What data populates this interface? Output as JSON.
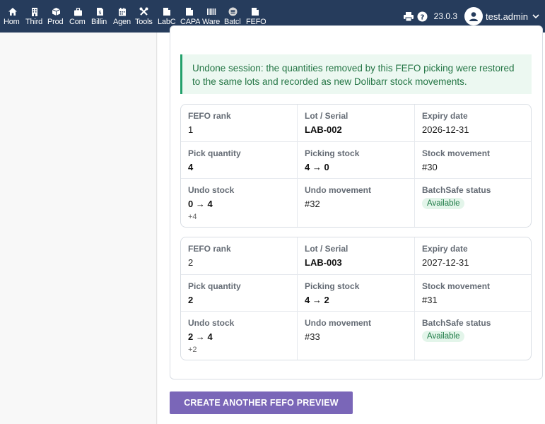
{
  "nav": {
    "items": [
      {
        "label": "Hom",
        "icon": "home-icon"
      },
      {
        "label": "Third",
        "icon": "building-icon"
      },
      {
        "label": "Prod",
        "icon": "cube-icon"
      },
      {
        "label": "Com",
        "icon": "briefcase-icon"
      },
      {
        "label": "Billin",
        "icon": "invoice-icon"
      },
      {
        "label": "Agen",
        "icon": "calendar-icon"
      },
      {
        "label": "Tools",
        "icon": "tools-icon"
      },
      {
        "label": "LabC",
        "icon": "doc-icon"
      },
      {
        "label": "CAPA",
        "icon": "doc-icon"
      },
      {
        "label": "Ware",
        "icon": "barcode-icon"
      },
      {
        "label": "Batcl",
        "icon": "batch-icon"
      },
      {
        "label": "FEFO",
        "icon": "doc-icon"
      }
    ]
  },
  "header": {
    "version": "23.0.3",
    "username": "test.admin"
  },
  "notice": {
    "text": "Undone session: the quantities removed by this FEFO picking were restored to the same lots and recorded as new Dolibarr stock movements."
  },
  "labels": {
    "rank": "FEFO rank",
    "lot": "Lot / Serial",
    "expiry": "Expiry date",
    "pick_qty": "Pick quantity",
    "picking_stock": "Picking stock",
    "stock_movement": "Stock movement",
    "undo_stock": "Undo stock",
    "undo_movement": "Undo movement",
    "status": "BatchSafe status"
  },
  "lines": [
    {
      "rank": "1",
      "lot": "LAB-002",
      "expiry": "2026-12-31",
      "pick_qty": "4",
      "picking_stock": "4 → 0",
      "stock_movement": "#30",
      "undo_stock": "0 → 4",
      "undo_delta": "+4",
      "undo_movement": "#32",
      "status": "Available"
    },
    {
      "rank": "2",
      "lot": "LAB-003",
      "expiry": "2027-12-31",
      "pick_qty": "2",
      "picking_stock": "4 → 2",
      "stock_movement": "#31",
      "undo_stock": "2 → 4",
      "undo_delta": "+2",
      "undo_movement": "#33",
      "status": "Available"
    }
  ],
  "cta": {
    "label": "CREATE ANOTHER FEFO PREVIEW"
  },
  "colors": {
    "topbar": "#263c5c",
    "notice_bg": "#ecf8f1",
    "notice_text": "#237544",
    "cta": "#7a66b8",
    "badge_bg": "#e3f5ea"
  }
}
